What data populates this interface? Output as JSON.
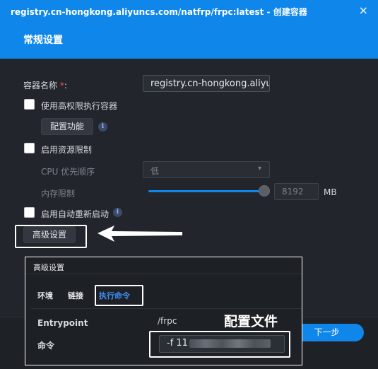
{
  "window": {
    "title": "registry.cn-hongkong.aliyuncs.com/natfrp/frpc:latest - 创建容器",
    "close_icon": "×"
  },
  "section_title": "常规设置",
  "form": {
    "container_name_label": "容器名称",
    "required_mark": "*",
    "colon": ":",
    "container_name_value": "registry.cn-hongkong.aliyuncs.com/natfrp/frpc:latest",
    "privileged_label": "使用高权限执行容器",
    "privileged_checked": false,
    "configure_features_button": "配置功能",
    "resource_limit_label": "启用资源限制",
    "resource_limit_checked": false,
    "cpu_priority_label": "CPU 优先顺序",
    "cpu_priority_value": "低",
    "memory_limit_label": "内存限制",
    "memory_limit_value": "8192",
    "memory_unit": "MB",
    "auto_restart_label": "启用自动重新启动",
    "auto_restart_checked": false,
    "advanced_settings_button": "高级设置",
    "info_icon": "i"
  },
  "footer": {
    "next_button": "下一步"
  },
  "advanced_panel": {
    "title": "高级设置",
    "tabs": [
      {
        "label": "环境",
        "active": false
      },
      {
        "label": "链接",
        "active": false
      },
      {
        "label": "执行命令",
        "active": true
      }
    ],
    "entrypoint_label": "Entrypoint",
    "entrypoint_value": "/frpc",
    "command_label": "命令",
    "command_value": "-f 11"
  },
  "annotation": {
    "label": "配置文件"
  },
  "colors": {
    "accent": "#0f86ea",
    "required": "#ff4d4f",
    "active_tab": "#3d8ef0",
    "highlight": "#ffffff"
  }
}
